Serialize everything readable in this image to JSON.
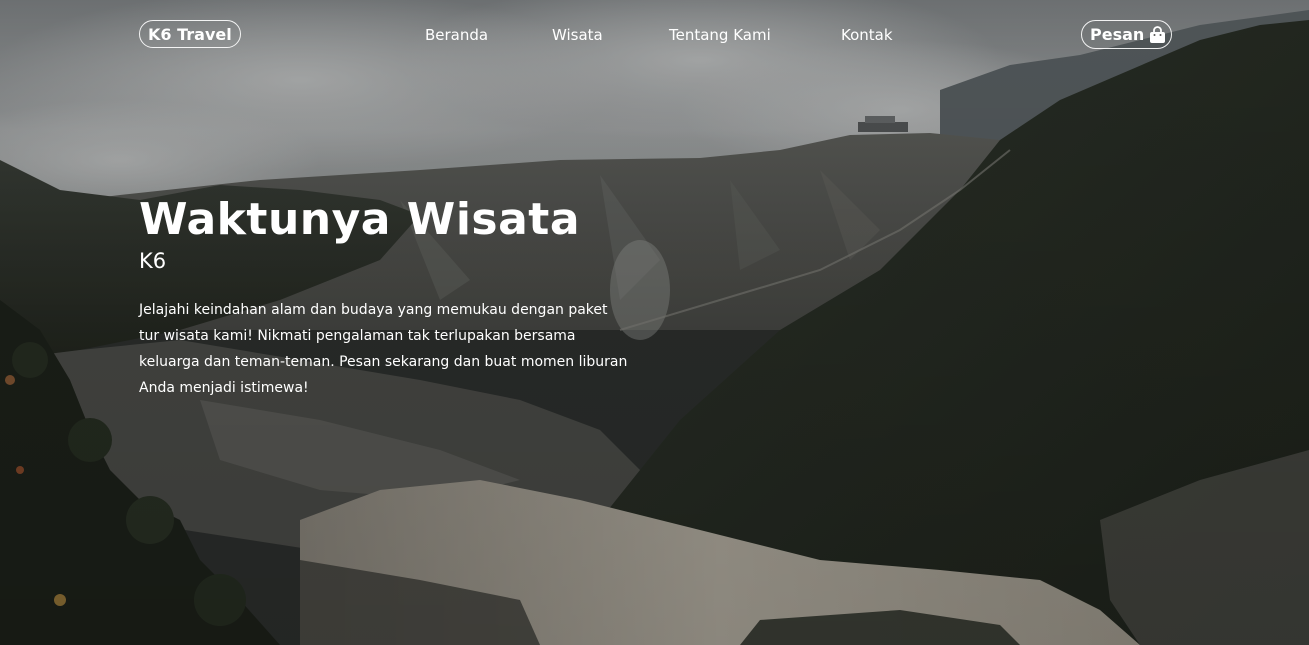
{
  "nav": {
    "brand": "K6 Travel",
    "links": [
      "Beranda",
      "Wisata",
      "Tentang Kami",
      "Kontak"
    ],
    "order_label": "Pesan",
    "order_icon": "shopping-bag-icon"
  },
  "hero": {
    "title": "Waktunya Wisata",
    "subtitle": "K6",
    "description": "Jelajahi keindahan alam dan budaya yang memukau dengan paket tur wisata kami! Nikmati pengalaman tak terlupakan bersama keluarga dan teman-teman. Pesan sekarang dan buat momen liburan Anda menjadi istimewa!"
  },
  "colors": {
    "text": "#ffffff",
    "sky": "#9a9d9f",
    "forest": "#2b302a",
    "crater_water": "#b8b3a4"
  }
}
